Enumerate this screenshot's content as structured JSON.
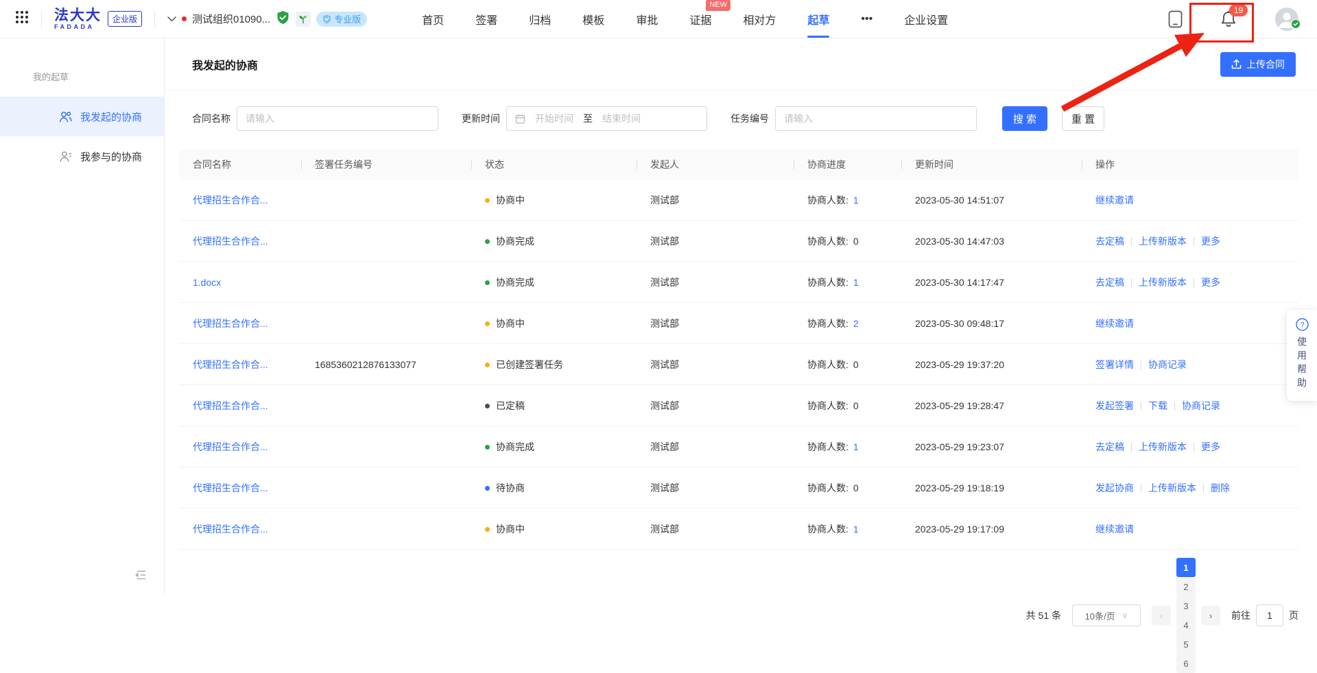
{
  "colors": {
    "primary": "#3370ff",
    "brand_logo": "#2836c9",
    "annotation_red": "#ec2313",
    "status_orange": "#faad14",
    "status_green": "#2ba245",
    "status_blue": "#3370ff",
    "status_dark": "#4d4d4d"
  },
  "header": {
    "logo_cn": "法大大",
    "logo_en": "FADADA",
    "edition_badge": "企业版",
    "org_name": "测试组织01090...",
    "pro_badge": "专业版",
    "notification_count": "19",
    "nav": [
      {
        "name": "home",
        "label": "首页"
      },
      {
        "name": "sign",
        "label": "签署"
      },
      {
        "name": "archive",
        "label": "归档"
      },
      {
        "name": "template",
        "label": "模板"
      },
      {
        "name": "approval",
        "label": "审批"
      },
      {
        "name": "evidence",
        "label": "证据",
        "badge": "NEW"
      },
      {
        "name": "counterparty",
        "label": "相对方"
      },
      {
        "name": "draft",
        "label": "起草",
        "active": true
      },
      {
        "name": "more",
        "label": "•••"
      },
      {
        "name": "enterprise-settings",
        "label": "企业设置"
      }
    ]
  },
  "sidebar": {
    "group_label": "我的起草",
    "items": [
      {
        "label": "我发起的协商",
        "active": true
      },
      {
        "label": "我参与的协商",
        "active": false
      }
    ]
  },
  "main": {
    "title": "我发起的协商",
    "upload_button": "上传合同",
    "filters": {
      "contract_name_label": "合同名称",
      "contract_name_placeholder": "请输入",
      "update_time_label": "更新时间",
      "start_placeholder": "开始时间",
      "to_text": "至",
      "end_placeholder": "结束时间",
      "task_no_label": "任务编号",
      "task_no_placeholder": "请输入",
      "search_button": "搜 索",
      "reset_button": "重 置"
    },
    "table": {
      "columns": [
        "合同名称",
        "签署任务编号",
        "状态",
        "发起人",
        "协商进度",
        "更新时间",
        "操作"
      ],
      "progress_label": "协商人数:",
      "rows": [
        {
          "name": "代理招生合作合...",
          "task_no": "",
          "status": "协商中",
          "status_color": "#faad14",
          "initiator": "测试部",
          "count": "1",
          "count_link": true,
          "updated": "2023-05-30 14:51:07",
          "actions": [
            "继续邀请"
          ]
        },
        {
          "name": "代理招生合作合...",
          "task_no": "",
          "status": "协商完成",
          "status_color": "#2ba245",
          "initiator": "测试部",
          "count": "0",
          "count_link": false,
          "updated": "2023-05-30 14:47:03",
          "actions": [
            "去定稿",
            "上传新版本",
            "更多"
          ]
        },
        {
          "name": "1.docx",
          "task_no": "",
          "status": "协商完成",
          "status_color": "#2ba245",
          "initiator": "测试部",
          "count": "1",
          "count_link": true,
          "updated": "2023-05-30 14:17:47",
          "actions": [
            "去定稿",
            "上传新版本",
            "更多"
          ]
        },
        {
          "name": "代理招生合作合...",
          "task_no": "",
          "status": "协商中",
          "status_color": "#faad14",
          "initiator": "测试部",
          "count": "2",
          "count_link": true,
          "updated": "2023-05-30 09:48:17",
          "actions": [
            "继续邀请"
          ]
        },
        {
          "name": "代理招生合作合...",
          "task_no": "1685360212876133077",
          "status": "已创建签署任务",
          "status_color": "#faad14",
          "initiator": "测试部",
          "count": "0",
          "count_link": false,
          "updated": "2023-05-29 19:37:20",
          "actions": [
            "签署详情",
            "协商记录"
          ]
        },
        {
          "name": "代理招生合作合...",
          "task_no": "",
          "status": "已定稿",
          "status_color": "#4d4d4d",
          "initiator": "测试部",
          "count": "0",
          "count_link": false,
          "updated": "2023-05-29 19:28:47",
          "actions": [
            "发起签署",
            "下载",
            "协商记录"
          ]
        },
        {
          "name": "代理招生合作合...",
          "task_no": "",
          "status": "协商完成",
          "status_color": "#2ba245",
          "initiator": "测试部",
          "count": "1",
          "count_link": true,
          "updated": "2023-05-29 19:23:07",
          "actions": [
            "去定稿",
            "上传新版本",
            "更多"
          ]
        },
        {
          "name": "代理招生合作合...",
          "task_no": "",
          "status": "待协商",
          "status_color": "#3370ff",
          "initiator": "测试部",
          "count": "0",
          "count_link": false,
          "updated": "2023-05-29 19:18:19",
          "actions": [
            "发起协商",
            "上传新版本",
            "删除"
          ]
        },
        {
          "name": "代理招生合作合...",
          "task_no": "",
          "status": "协商中",
          "status_color": "#faad14",
          "initiator": "测试部",
          "count": "1",
          "count_link": true,
          "updated": "2023-05-29 19:17:09",
          "actions": [
            "继续邀请"
          ]
        }
      ]
    },
    "pagination": {
      "total": "共 51 条",
      "page_size": "10条/页",
      "pages": [
        "1",
        "2",
        "3",
        "4",
        "5",
        "6"
      ],
      "active_page": "1",
      "goto_label": "前往",
      "goto_value": "1",
      "goto_suffix": "页"
    }
  },
  "help_widget": {
    "label": "使用帮助"
  }
}
